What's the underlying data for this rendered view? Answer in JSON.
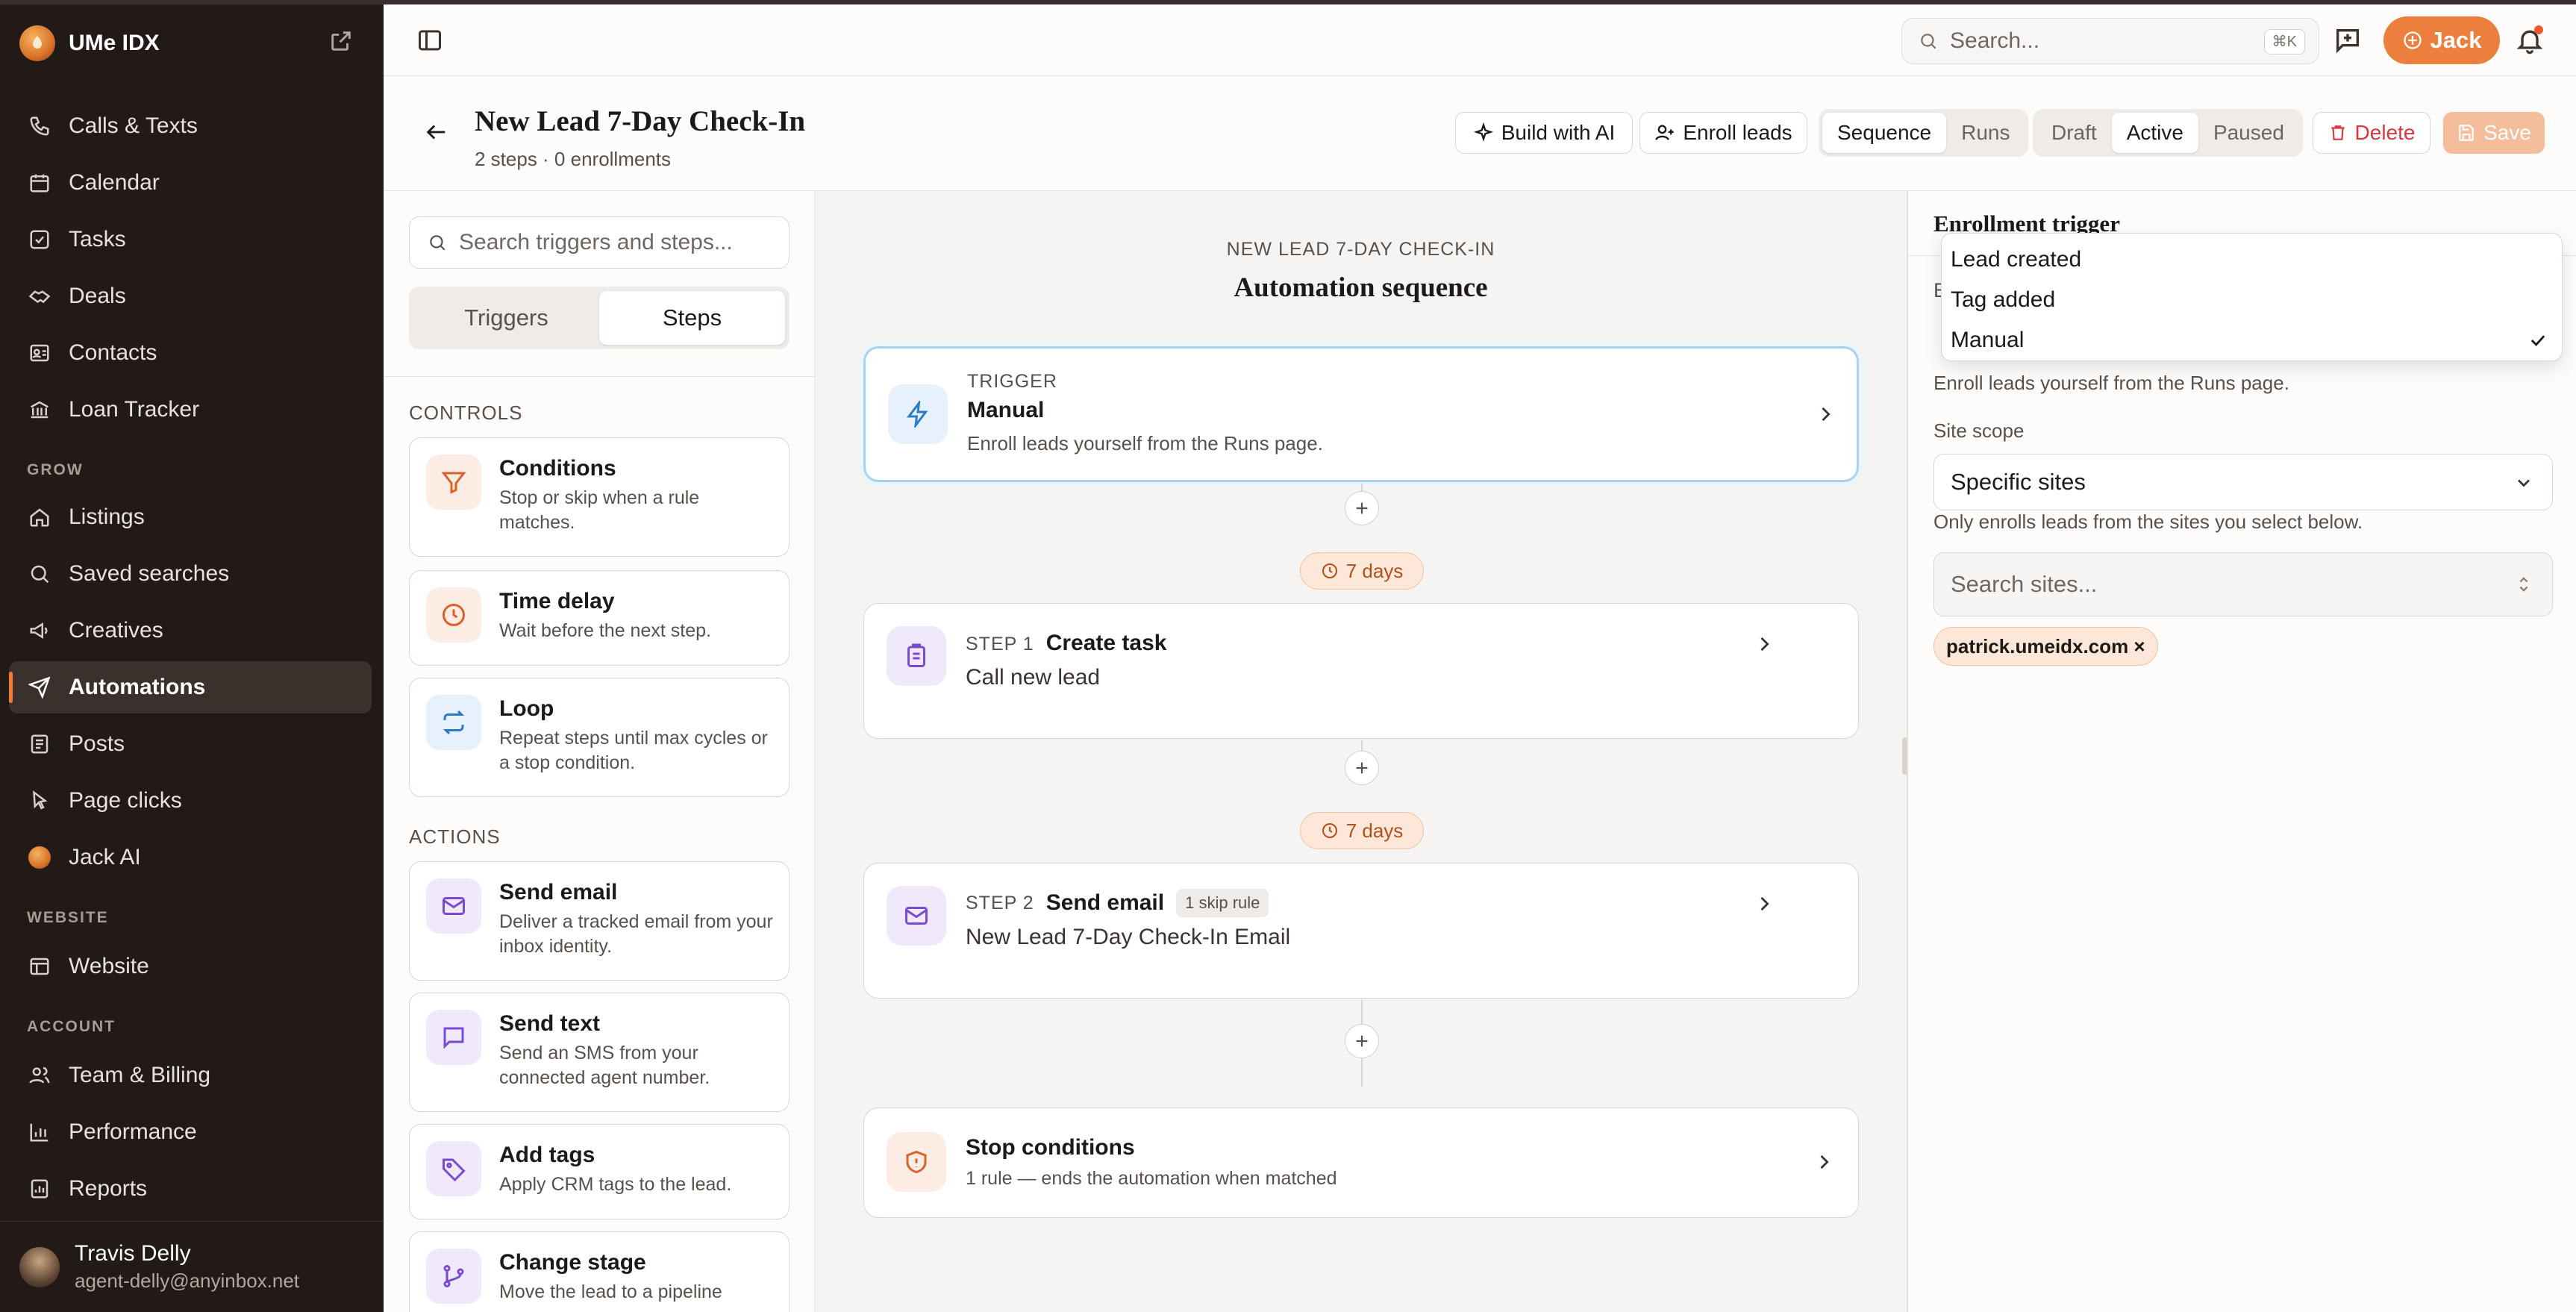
{
  "app": {
    "name": "UMe IDX"
  },
  "sidebar": {
    "items_top": [
      {
        "label": "Calls & Texts",
        "icon": "phone-icon"
      },
      {
        "label": "Calendar",
        "icon": "calendar-icon"
      },
      {
        "label": "Tasks",
        "icon": "checkbox-icon"
      },
      {
        "label": "Deals",
        "icon": "handshake-icon"
      },
      {
        "label": "Contacts",
        "icon": "contact-card-icon"
      },
      {
        "label": "Loan Tracker",
        "icon": "bank-icon"
      }
    ],
    "section_grow": "GROW",
    "items_grow": [
      {
        "label": "Listings",
        "icon": "home-icon"
      },
      {
        "label": "Saved searches",
        "icon": "search-icon"
      },
      {
        "label": "Creatives",
        "icon": "megaphone-icon"
      },
      {
        "label": "Automations",
        "icon": "send-icon"
      },
      {
        "label": "Posts",
        "icon": "document-icon"
      },
      {
        "label": "Page clicks",
        "icon": "pointer-icon"
      },
      {
        "label": "Jack AI",
        "icon": "jack-avatar-icon"
      }
    ],
    "section_website": "WEBSITE",
    "items_website": [
      {
        "label": "Website",
        "icon": "layout-icon"
      }
    ],
    "section_account": "ACCOUNT",
    "items_account": [
      {
        "label": "Team & Billing",
        "icon": "users-icon"
      },
      {
        "label": "Performance",
        "icon": "bar-chart-icon"
      },
      {
        "label": "Reports",
        "icon": "report-icon"
      }
    ],
    "active": "Automations",
    "user": {
      "name": "Travis Delly",
      "email": "agent-delly@anyinbox.net"
    }
  },
  "topbar": {
    "search_placeholder": "Search...",
    "shortcut": "⌘K",
    "jack_label": "Jack"
  },
  "header": {
    "title": "New Lead 7-Day Check-In",
    "subtitle": "2 steps · 0 enrollments",
    "build_ai": "Build with AI",
    "enroll": "Enroll leads",
    "view_tabs": [
      "Sequence",
      "Runs"
    ],
    "view_active": "Sequence",
    "status_tabs": [
      "Draft",
      "Active",
      "Paused"
    ],
    "status_active": "Active",
    "delete": "Delete",
    "save": "Save"
  },
  "palette": {
    "search_placeholder": "Search triggers and steps...",
    "tabs": [
      "Triggers",
      "Steps"
    ],
    "active_tab": "Steps",
    "controls_label": "CONTROLS",
    "controls": [
      {
        "title": "Conditions",
        "desc": "Stop or skip when a rule matches.",
        "icon": "filter-icon"
      },
      {
        "title": "Time delay",
        "desc": "Wait before the next step.",
        "icon": "clock-icon"
      },
      {
        "title": "Loop",
        "desc": "Repeat steps until max cycles or a stop condition.",
        "icon": "repeat-icon"
      }
    ],
    "actions_label": "ACTIONS",
    "actions": [
      {
        "title": "Send email",
        "desc": "Deliver a tracked email from your inbox identity.",
        "icon": "mail-icon"
      },
      {
        "title": "Send text",
        "desc": "Send an SMS from your connected agent number.",
        "icon": "message-icon"
      },
      {
        "title": "Add tags",
        "desc": "Apply CRM tags to the lead.",
        "icon": "tag-icon"
      },
      {
        "title": "Change stage",
        "desc": "Move the lead to a pipeline",
        "icon": "branch-icon"
      }
    ]
  },
  "canvas": {
    "kicker": "NEW LEAD 7-DAY CHECK-IN",
    "title": "Automation sequence",
    "trigger": {
      "kicker": "TRIGGER",
      "title": "Manual",
      "desc": "Enroll leads yourself from the Runs page."
    },
    "delay1": "7 days",
    "step1": {
      "kicker": "STEP 1",
      "title": "Create task",
      "desc": "Call new lead"
    },
    "delay2": "7 days",
    "step2": {
      "kicker": "STEP 2",
      "title": "Send email",
      "badge": "1 skip rule",
      "desc": "New Lead 7-Day Check-In Email"
    },
    "stop": {
      "title": "Stop conditions",
      "desc": "1 rule — ends the automation when matched"
    }
  },
  "panel": {
    "title": "Enrollment trigger",
    "hidden_label": "E",
    "options": [
      "Lead created",
      "Tag added",
      "Manual"
    ],
    "selected_option": "Manual",
    "trigger_help": "Enroll leads yourself from the Runs page.",
    "site_scope_label": "Site scope",
    "site_scope_value": "Specific sites",
    "site_scope_help": "Only enrolls leads from the sites you select below.",
    "site_search_placeholder": "Search sites...",
    "selected_site": "patrick.umeidx.com ×"
  },
  "colors": {
    "accent": "#ec7f3e",
    "sidebar_bg": "#211a17",
    "selected_border": "#a9d2ef",
    "danger": "#d9363e"
  }
}
